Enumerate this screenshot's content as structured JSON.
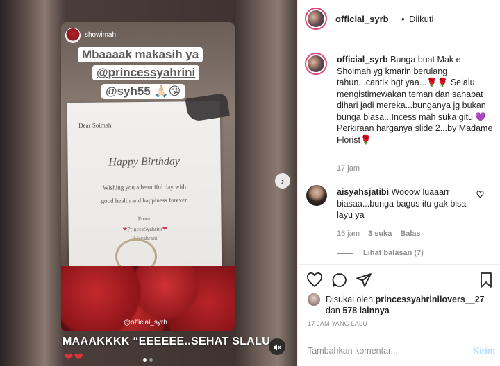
{
  "media": {
    "story_user": "showimah",
    "sticker_line1": "Mbaaaak makasih ya",
    "sticker_line2": "@princessyahrini",
    "sticker_line3": "@syh55 🙏🏻😘",
    "card": {
      "dear": "Dear Soimah,",
      "happy_birthday": "Happy Birthday",
      "wish_line1": "Wishing you a beautiful day with",
      "wish_line2": "good health and happiness forever.",
      "from": "From:",
      "sender": "PrincesSyahrini",
      "sender2": "Aisyahrani"
    },
    "watermark": "@official_syrb",
    "overlay_caption": "MAAAKKKK “EEEEEE..SEHAT SLALU",
    "overlay_hearts": "❤❤",
    "next_icon": "chevron-right-icon",
    "mute_icon": "speaker-muted-icon"
  },
  "header": {
    "username": "official_syrb",
    "separator": "•",
    "follow_status": "Diikuti"
  },
  "caption": {
    "username": "official_syrb",
    "text": "Bunga buat Mak e Shoimah yg kmarin berulang tahun...cantik bgt yaa...🌹🌹 Selalu mengistimewakan teman dan sahabat dihari jadi mereka...bunganya jg bukan bunga biasa...Incess mah suka gitu 💜 Perkiraan harganya slide 2...by Madame Florist🌹",
    "time": "17 jam"
  },
  "comment": {
    "username": "aisyahsjatibi",
    "text": "Wooow luaaarr biasaa...bunga bagus itu gak bisa layu ya",
    "time": "16 jam",
    "likes": "3 suka",
    "reply": "Balas",
    "view_replies": "Lihat balasan (7)"
  },
  "actions": {
    "liked_by_prefix": "Disukai oleh",
    "liked_by_user": "princessyahrinilovers__27",
    "liked_by_and": "dan",
    "liked_by_count": "578 lainnya",
    "post_date": "17 JAM YANG LALU"
  },
  "add_comment": {
    "placeholder": "Tambahkan komentar...",
    "post_label": "Kirim"
  },
  "colors": {
    "text": "#262626",
    "muted": "#8e8e8e",
    "post_disabled": "#b2dffc",
    "story_ring": "#e0457b"
  }
}
